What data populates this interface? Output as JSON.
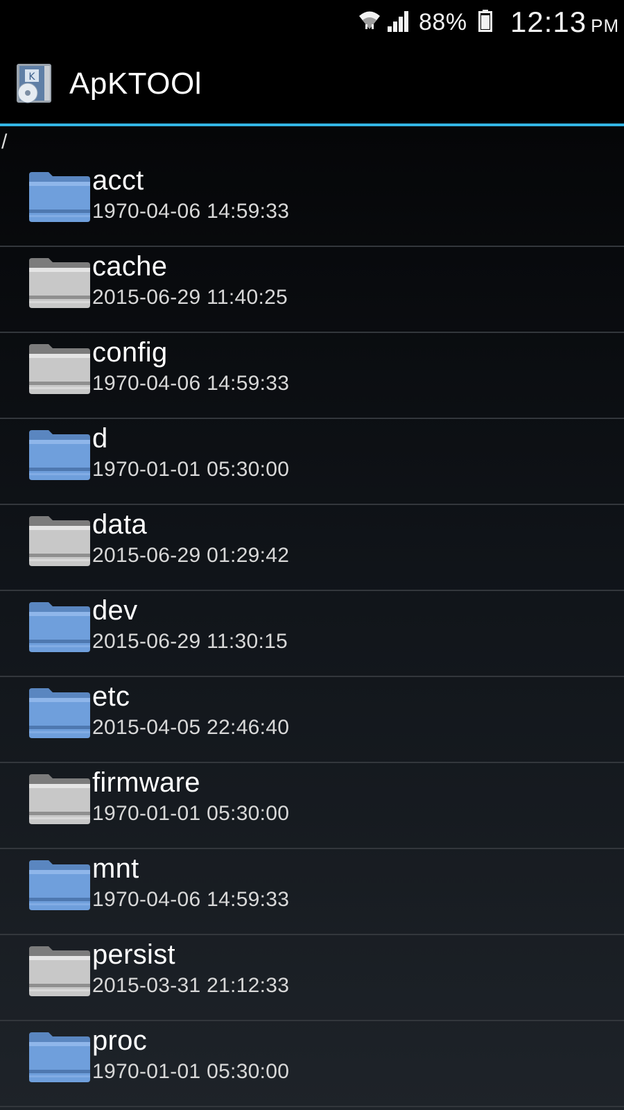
{
  "status_bar": {
    "battery_percent": "88%",
    "time": "12:13",
    "ampm": "PM",
    "icons": [
      "wifi-icon",
      "signal-icon",
      "battery-icon"
    ]
  },
  "action_bar": {
    "title": "ApKTOOl",
    "icon": "app-icon"
  },
  "browser": {
    "path": "/",
    "entries": [
      {
        "name": "acct",
        "date": "1970-04-06 14:59:33",
        "folder_color": "blue"
      },
      {
        "name": "cache",
        "date": "2015-06-29 11:40:25",
        "folder_color": "gray"
      },
      {
        "name": "config",
        "date": "1970-04-06 14:59:33",
        "folder_color": "gray"
      },
      {
        "name": "d",
        "date": "1970-01-01 05:30:00",
        "folder_color": "blue"
      },
      {
        "name": "data",
        "date": "2015-06-29 01:29:42",
        "folder_color": "gray"
      },
      {
        "name": "dev",
        "date": "2015-06-29 11:30:15",
        "folder_color": "blue"
      },
      {
        "name": "etc",
        "date": "2015-04-05 22:46:40",
        "folder_color": "blue"
      },
      {
        "name": "firmware",
        "date": "1970-01-01 05:30:00",
        "folder_color": "gray"
      },
      {
        "name": "mnt",
        "date": "1970-04-06 14:59:33",
        "folder_color": "blue"
      },
      {
        "name": "persist",
        "date": "2015-03-31 21:12:33",
        "folder_color": "gray"
      },
      {
        "name": "proc",
        "date": "1970-01-01 05:30:00",
        "folder_color": "blue"
      }
    ]
  },
  "colors": {
    "accent": "#33b5e5",
    "folder_blue": "#6f9fdc",
    "folder_gray": "#c8c8c8"
  }
}
